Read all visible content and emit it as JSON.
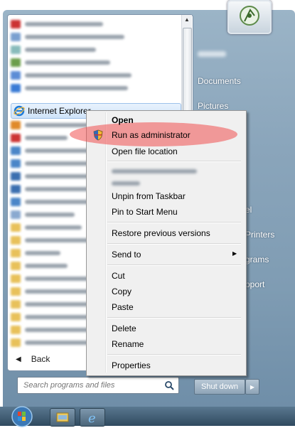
{
  "start_menu": {
    "pinned_item": "Internet Explorer",
    "back_label": "Back",
    "search_placeholder": "Search programs and files",
    "shutdown_label": "Shut down"
  },
  "right_pane": {
    "items": [
      "Documents",
      "Pictures",
      "el",
      "Printers",
      "grams",
      "pport"
    ]
  },
  "context_menu": {
    "items": {
      "open": "Open",
      "run_as_admin": "Run as administrator",
      "open_file_location": "Open file location",
      "unpin_taskbar": "Unpin from Taskbar",
      "pin_start": "Pin to Start Menu",
      "restore_versions": "Restore previous versions",
      "send_to": "Send to",
      "cut": "Cut",
      "copy": "Copy",
      "paste": "Paste",
      "delete": "Delete",
      "rename": "Rename",
      "properties": "Properties"
    },
    "highlight_color": "#f05050"
  },
  "colors": {
    "frame": "#8aa5bb",
    "taskbar": "#2f4a5f",
    "selection": "#cfe3f8"
  }
}
